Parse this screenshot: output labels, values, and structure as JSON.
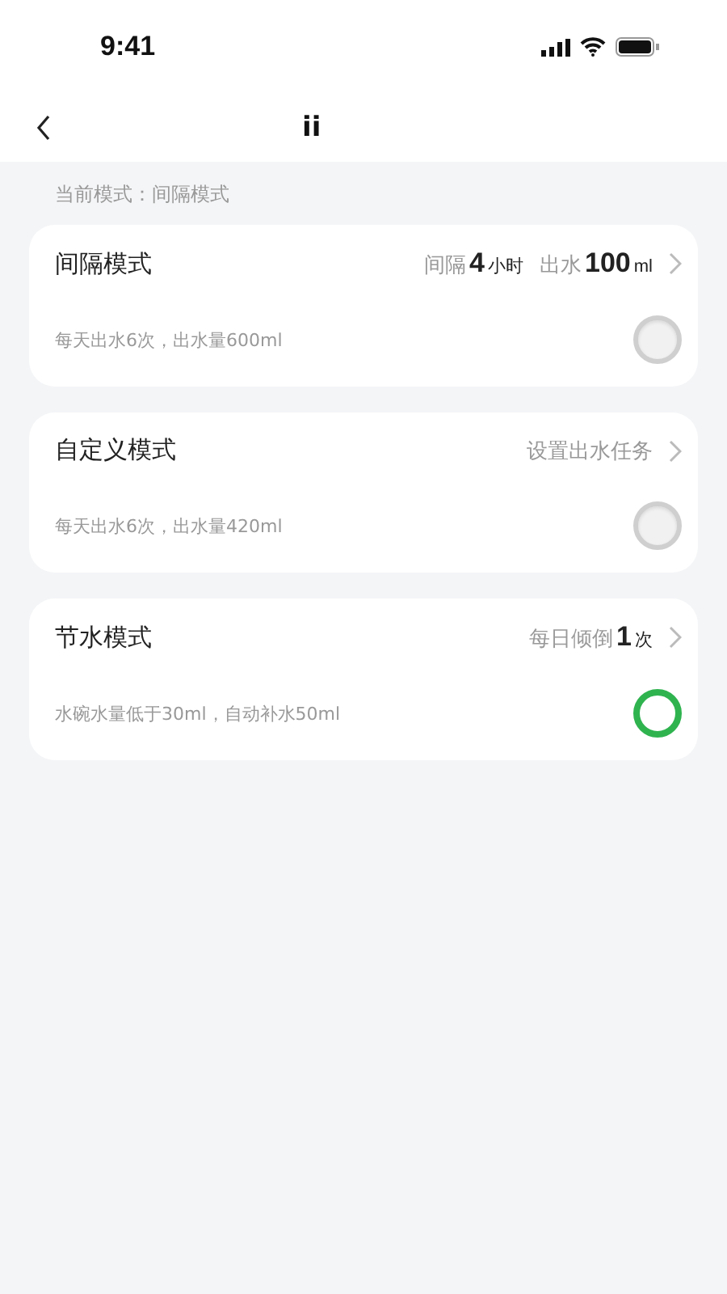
{
  "status_bar": {
    "time": "9:41"
  },
  "nav": {
    "title": "ii"
  },
  "current_mode": "当前模式：间隔模式",
  "modes": [
    {
      "title": "间隔模式",
      "summary": [
        {
          "kind": "label",
          "text": "间隔"
        },
        {
          "kind": "value",
          "text": "4"
        },
        {
          "kind": "unit",
          "text": "小时"
        },
        {
          "kind": "label",
          "text": "出水"
        },
        {
          "kind": "value",
          "text": "100"
        },
        {
          "kind": "unit",
          "text": "ml"
        }
      ],
      "description": "每天出水6次，出水量600ml",
      "selected": false
    },
    {
      "title": "自定义模式",
      "summary": [
        {
          "kind": "label",
          "text": "设置出水任务"
        }
      ],
      "description": "每天出水6次，出水量420ml",
      "selected": false
    },
    {
      "title": "节水模式",
      "summary": [
        {
          "kind": "label",
          "text": "每日倾倒"
        },
        {
          "kind": "value",
          "text": "1"
        },
        {
          "kind": "unit",
          "text": "次"
        }
      ],
      "description": "水碗水量低于30ml，自动补水50ml",
      "selected": true
    }
  ]
}
